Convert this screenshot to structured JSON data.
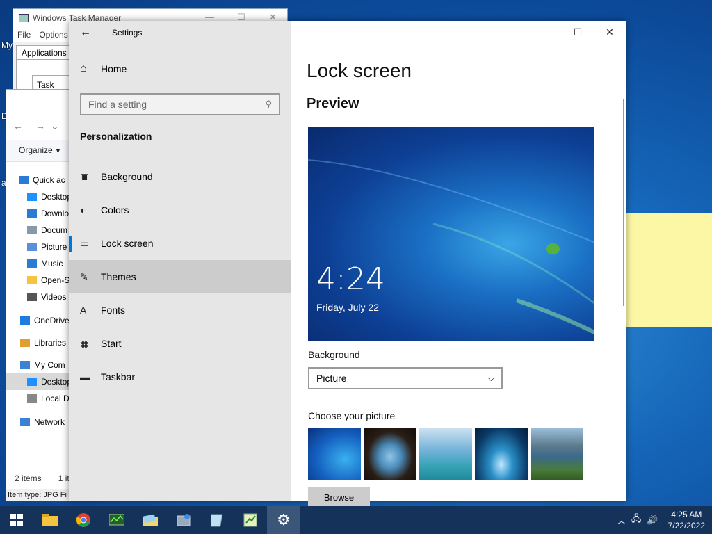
{
  "desktop": {
    "my_computer_label": "My",
    "left_label_1": "D",
    "left_label_2": "a"
  },
  "task_manager": {
    "title": "Windows Task Manager",
    "menu": [
      "File",
      "Options"
    ],
    "tab": "Applications",
    "column": "Task"
  },
  "explorer": {
    "organize": "Organize",
    "tree": [
      {
        "label": "Quick ac",
        "icon": "star-icon",
        "color": "#2a7bd6"
      },
      {
        "label": "Desktop",
        "icon": "desktop-icon",
        "color": "#1e90ff"
      },
      {
        "label": "Downlo",
        "icon": "download-icon",
        "color": "#2a7bd6"
      },
      {
        "label": "Docum",
        "icon": "document-icon",
        "color": "#8899aa"
      },
      {
        "label": "Picture",
        "icon": "pictures-icon",
        "color": "#5b8fd9"
      },
      {
        "label": "Music",
        "icon": "music-icon",
        "color": "#2a7bd6"
      },
      {
        "label": "Open-S",
        "icon": "folder-icon",
        "color": "#f5c542"
      },
      {
        "label": "Videos",
        "icon": "video-icon",
        "color": "#555"
      },
      {
        "label": "OneDrive",
        "icon": "cloud-icon",
        "color": "#1e7be0"
      },
      {
        "label": "Libraries",
        "icon": "library-icon",
        "color": "#e0a030"
      },
      {
        "label": "My Com",
        "icon": "computer-icon",
        "color": "#3b82d6"
      },
      {
        "label": "Desktop",
        "icon": "desktop-icon",
        "color": "#1e90ff"
      },
      {
        "label": "Local D",
        "icon": "drive-icon",
        "color": "#888"
      },
      {
        "label": "Network",
        "icon": "network-icon",
        "color": "#3b82d6"
      }
    ],
    "status_items": "2 items",
    "status_selected": "1 it",
    "item_type": "Item type: JPG Fi"
  },
  "settings": {
    "app_title": "Settings",
    "home": "Home",
    "search_placeholder": "Find a setting",
    "section": "Personalization",
    "nav": [
      {
        "label": "Background",
        "icon": "image-icon",
        "glyph": "▣"
      },
      {
        "label": "Colors",
        "icon": "palette-icon",
        "glyph": "◐"
      },
      {
        "label": "Lock screen",
        "icon": "lock-screen-icon",
        "glyph": "▭"
      },
      {
        "label": "Themes",
        "icon": "brush-icon",
        "glyph": "✎"
      },
      {
        "label": "Fonts",
        "icon": "font-icon",
        "glyph": "A"
      },
      {
        "label": "Start",
        "icon": "start-icon",
        "glyph": "▦"
      },
      {
        "label": "Taskbar",
        "icon": "taskbar-icon",
        "glyph": "▬"
      }
    ],
    "active_index": 2,
    "hover_index": 3,
    "page_title": "Lock screen",
    "preview_heading": "Preview",
    "preview_time": "4:24",
    "preview_date": "Friday, July 22",
    "background_label": "Background",
    "background_value": "Picture",
    "choose_label": "Choose your picture",
    "browse": "Browse"
  },
  "taskbar": {
    "time": "4:25 AM",
    "date": "7/22/2022",
    "apps": [
      "file-explorer",
      "chrome",
      "task-manager",
      "folder",
      "control-panel",
      "notepad",
      "sticky-notes",
      "settings"
    ]
  },
  "colors": {
    "accent": "#0078d7",
    "taskbar": "#15325a"
  }
}
